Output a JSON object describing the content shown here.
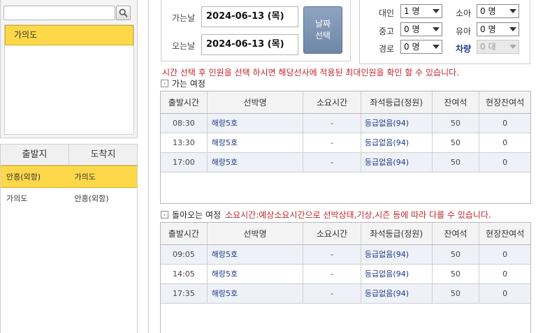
{
  "left": {
    "search": {
      "value": "",
      "placeholder": ""
    },
    "destinations": [
      {
        "label": "가의도"
      }
    ],
    "route_header": {
      "departure": "출발지",
      "arrival": "도착지"
    },
    "routes": [
      {
        "from": "안흥(외항)",
        "to": "가의도"
      },
      {
        "from": "가의도",
        "to": "안흥(외항)"
      }
    ]
  },
  "dates": {
    "depart_label": "가는날",
    "depart_value": "2024-06-13 (목)",
    "return_label": "오는날",
    "return_value": "2024-06-13 (목)",
    "select_line1": "날짜",
    "select_line2": "선택"
  },
  "passengers": {
    "adult_label": "대인",
    "adult_value": "1 명",
    "child_label": "소아",
    "child_value": "0 명",
    "senior_label": "중고",
    "senior_value": "0 명",
    "infant_label": "유아",
    "infant_value": "0 명",
    "discount_label": "경로",
    "discount_value": "0 명",
    "vehicle_label": "차량",
    "vehicle_value": "0 대"
  },
  "notice": "시간 선택 후 인원을 선택 하시면 해당선사에 적용된 최대인원을 확인 할 수 있습니다.",
  "outbound": {
    "title": "가는 여정",
    "columns": [
      "출발시간",
      "선박명",
      "소요시간",
      "좌석등급(정원)",
      "잔여석",
      "현장잔여석"
    ],
    "rows": [
      {
        "time": "08:30",
        "ship": "해랑5호",
        "duration": "-",
        "seat": "등급없음(94)",
        "remain": "50",
        "onsite": "0"
      },
      {
        "time": "13:30",
        "ship": "해랑5호",
        "duration": "-",
        "seat": "등급없음(94)",
        "remain": "50",
        "onsite": "0"
      },
      {
        "time": "17:00",
        "ship": "해랑5호",
        "duration": "-",
        "seat": "등급없음(94)",
        "remain": "50",
        "onsite": "0"
      }
    ]
  },
  "inbound": {
    "title": "돌아오는 여정",
    "warning": "소요시간:예상소요시간으로 선박상태,기상,시즌 등에 따라 다를 수 있습니다.",
    "columns": [
      "출발시간",
      "선박명",
      "소요시간",
      "좌석등급(정원)",
      "잔여석",
      "현장잔여석"
    ],
    "rows": [
      {
        "time": "09:05",
        "ship": "해랑5호",
        "duration": "-",
        "seat": "등급없음(94)",
        "remain": "50",
        "onsite": "0"
      },
      {
        "time": "14:05",
        "ship": "해랑5호",
        "duration": "-",
        "seat": "등급없음(94)",
        "remain": "50",
        "onsite": "0"
      },
      {
        "time": "17:35",
        "ship": "해랑5호",
        "duration": "-",
        "seat": "등급없음(94)",
        "remain": "50",
        "onsite": "0"
      }
    ]
  }
}
